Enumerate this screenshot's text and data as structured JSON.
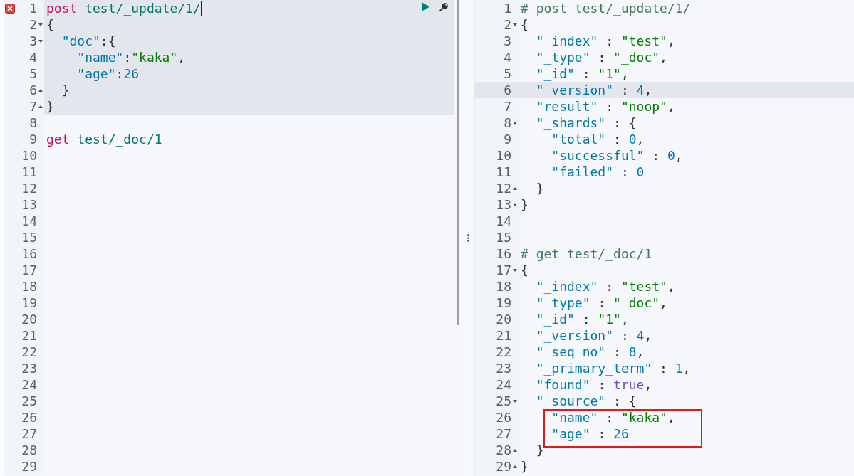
{
  "request_editor": {
    "lines": [
      {
        "n": "1",
        "error": true,
        "active": true,
        "cursor": true,
        "tokens": [
          {
            "text": "post",
            "kind": "method"
          },
          {
            "text": " test/_update/1/",
            "kind": "url"
          }
        ]
      },
      {
        "n": "2",
        "fold_open": true,
        "active": true,
        "tokens": [
          {
            "text": "{",
            "kind": "punct"
          }
        ]
      },
      {
        "n": "3",
        "fold_open": true,
        "active": true,
        "tokens": [
          {
            "text": "  \"doc\"",
            "kind": "key"
          },
          {
            "text": ":{",
            "kind": "punct"
          }
        ]
      },
      {
        "n": "4",
        "active": true,
        "tokens": [
          {
            "text": "    \"name\"",
            "kind": "key"
          },
          {
            "text": ":",
            "kind": "punct"
          },
          {
            "text": "\"kaka\"",
            "kind": "string"
          },
          {
            "text": ",",
            "kind": "punct"
          }
        ]
      },
      {
        "n": "5",
        "active": true,
        "tokens": [
          {
            "text": "    \"age\"",
            "kind": "key"
          },
          {
            "text": ":",
            "kind": "punct"
          },
          {
            "text": "26",
            "kind": "number"
          }
        ]
      },
      {
        "n": "6",
        "fold_close": true,
        "active": true,
        "tokens": [
          {
            "text": "  }",
            "kind": "punct"
          }
        ]
      },
      {
        "n": "7",
        "fold_close": true,
        "active": true,
        "tokens": [
          {
            "text": "}",
            "kind": "punct"
          }
        ]
      },
      {
        "n": "8"
      },
      {
        "n": "9",
        "tokens": [
          {
            "text": "get",
            "kind": "method"
          },
          {
            "text": " test/_doc/1",
            "kind": "url"
          }
        ]
      },
      {
        "n": "10"
      },
      {
        "n": "11"
      },
      {
        "n": "12"
      },
      {
        "n": "13"
      },
      {
        "n": "14"
      },
      {
        "n": "15"
      },
      {
        "n": "16"
      },
      {
        "n": "17"
      },
      {
        "n": "18"
      },
      {
        "n": "19"
      },
      {
        "n": "20"
      },
      {
        "n": "21"
      },
      {
        "n": "22"
      },
      {
        "n": "23"
      },
      {
        "n": "24"
      },
      {
        "n": "25"
      },
      {
        "n": "26"
      },
      {
        "n": "27"
      },
      {
        "n": "28"
      },
      {
        "n": "29"
      }
    ]
  },
  "response_viewer": {
    "lines": [
      {
        "n": "1",
        "tokens": [
          {
            "text": "# post test/_update/1/",
            "kind": "comment"
          }
        ]
      },
      {
        "n": "2",
        "fold_open": true,
        "tokens": [
          {
            "text": "{",
            "kind": "punct"
          }
        ]
      },
      {
        "n": "3",
        "tokens": [
          {
            "text": "  \"_index\"",
            "kind": "key"
          },
          {
            "text": " : ",
            "kind": "punct"
          },
          {
            "text": "\"test\"",
            "kind": "string"
          },
          {
            "text": ",",
            "kind": "punct"
          }
        ]
      },
      {
        "n": "4",
        "tokens": [
          {
            "text": "  \"_type\"",
            "kind": "key"
          },
          {
            "text": " : ",
            "kind": "punct"
          },
          {
            "text": "\"_doc\"",
            "kind": "string"
          },
          {
            "text": ",",
            "kind": "punct"
          }
        ]
      },
      {
        "n": "5",
        "tokens": [
          {
            "text": "  \"_id\"",
            "kind": "key"
          },
          {
            "text": " : ",
            "kind": "punct"
          },
          {
            "text": "\"1\"",
            "kind": "string"
          },
          {
            "text": ",",
            "kind": "punct"
          }
        ]
      },
      {
        "n": "6",
        "active": true,
        "cursor": true,
        "tokens": [
          {
            "text": "  \"_version\"",
            "kind": "key"
          },
          {
            "text": " : ",
            "kind": "punct"
          },
          {
            "text": "4",
            "kind": "number"
          },
          {
            "text": ",",
            "kind": "punct"
          }
        ]
      },
      {
        "n": "7",
        "tokens": [
          {
            "text": "  \"result\"",
            "kind": "key"
          },
          {
            "text": " : ",
            "kind": "punct"
          },
          {
            "text": "\"noop\"",
            "kind": "string"
          },
          {
            "text": ",",
            "kind": "punct"
          }
        ]
      },
      {
        "n": "8",
        "fold_open": true,
        "tokens": [
          {
            "text": "  \"_shards\"",
            "kind": "key"
          },
          {
            "text": " : {",
            "kind": "punct"
          }
        ]
      },
      {
        "n": "9",
        "tokens": [
          {
            "text": "    \"total\"",
            "kind": "key"
          },
          {
            "text": " : ",
            "kind": "punct"
          },
          {
            "text": "0",
            "kind": "number"
          },
          {
            "text": ",",
            "kind": "punct"
          }
        ]
      },
      {
        "n": "10",
        "tokens": [
          {
            "text": "    \"successful\"",
            "kind": "key"
          },
          {
            "text": " : ",
            "kind": "punct"
          },
          {
            "text": "0",
            "kind": "number"
          },
          {
            "text": ",",
            "kind": "punct"
          }
        ]
      },
      {
        "n": "11",
        "tokens": [
          {
            "text": "    \"failed\"",
            "kind": "key"
          },
          {
            "text": " : ",
            "kind": "punct"
          },
          {
            "text": "0",
            "kind": "number"
          }
        ]
      },
      {
        "n": "12",
        "fold_close": true,
        "tokens": [
          {
            "text": "  }",
            "kind": "punct"
          }
        ]
      },
      {
        "n": "13",
        "fold_close": true,
        "tokens": [
          {
            "text": "}",
            "kind": "punct"
          }
        ]
      },
      {
        "n": "14"
      },
      {
        "n": "15"
      },
      {
        "n": "16",
        "tokens": [
          {
            "text": "# get test/_doc/1",
            "kind": "comment"
          }
        ]
      },
      {
        "n": "17",
        "fold_open": true,
        "tokens": [
          {
            "text": "{",
            "kind": "punct"
          }
        ]
      },
      {
        "n": "18",
        "tokens": [
          {
            "text": "  \"_index\"",
            "kind": "key"
          },
          {
            "text": " : ",
            "kind": "punct"
          },
          {
            "text": "\"test\"",
            "kind": "string"
          },
          {
            "text": ",",
            "kind": "punct"
          }
        ]
      },
      {
        "n": "19",
        "tokens": [
          {
            "text": "  \"_type\"",
            "kind": "key"
          },
          {
            "text": " : ",
            "kind": "punct"
          },
          {
            "text": "\"_doc\"",
            "kind": "string"
          },
          {
            "text": ",",
            "kind": "punct"
          }
        ]
      },
      {
        "n": "20",
        "tokens": [
          {
            "text": "  \"_id\"",
            "kind": "key"
          },
          {
            "text": " : ",
            "kind": "punct"
          },
          {
            "text": "\"1\"",
            "kind": "string"
          },
          {
            "text": ",",
            "kind": "punct"
          }
        ]
      },
      {
        "n": "21",
        "tokens": [
          {
            "text": "  \"_version\"",
            "kind": "key"
          },
          {
            "text": " : ",
            "kind": "punct"
          },
          {
            "text": "4",
            "kind": "number"
          },
          {
            "text": ",",
            "kind": "punct"
          }
        ]
      },
      {
        "n": "22",
        "tokens": [
          {
            "text": "  \"_seq_no\"",
            "kind": "key"
          },
          {
            "text": " : ",
            "kind": "punct"
          },
          {
            "text": "8",
            "kind": "number"
          },
          {
            "text": ",",
            "kind": "punct"
          }
        ]
      },
      {
        "n": "23",
        "tokens": [
          {
            "text": "  \"_primary_term\"",
            "kind": "key"
          },
          {
            "text": " : ",
            "kind": "punct"
          },
          {
            "text": "1",
            "kind": "number"
          },
          {
            "text": ",",
            "kind": "punct"
          }
        ]
      },
      {
        "n": "24",
        "tokens": [
          {
            "text": "  \"found\"",
            "kind": "key"
          },
          {
            "text": " : ",
            "kind": "punct"
          },
          {
            "text": "true",
            "kind": "bool"
          },
          {
            "text": ",",
            "kind": "punct"
          }
        ]
      },
      {
        "n": "25",
        "fold_open": true,
        "tokens": [
          {
            "text": "  \"_source\"",
            "kind": "key"
          },
          {
            "text": " : {",
            "kind": "punct"
          }
        ]
      },
      {
        "n": "26",
        "boxed": true,
        "tokens": [
          {
            "text": "    \"name\"",
            "kind": "key"
          },
          {
            "text": " : ",
            "kind": "punct"
          },
          {
            "text": "\"kaka\"",
            "kind": "string"
          },
          {
            "text": ",",
            "kind": "punct"
          }
        ]
      },
      {
        "n": "27",
        "boxed": true,
        "tokens": [
          {
            "text": "    \"age\"",
            "kind": "key"
          },
          {
            "text": " : ",
            "kind": "punct"
          },
          {
            "text": "26",
            "kind": "number"
          }
        ]
      },
      {
        "n": "28",
        "fold_close": true,
        "tokens": [
          {
            "text": "  }",
            "kind": "punct"
          }
        ]
      },
      {
        "n": "29",
        "fold_close": true,
        "tokens": [
          {
            "text": "}",
            "kind": "punct"
          }
        ]
      }
    ]
  }
}
